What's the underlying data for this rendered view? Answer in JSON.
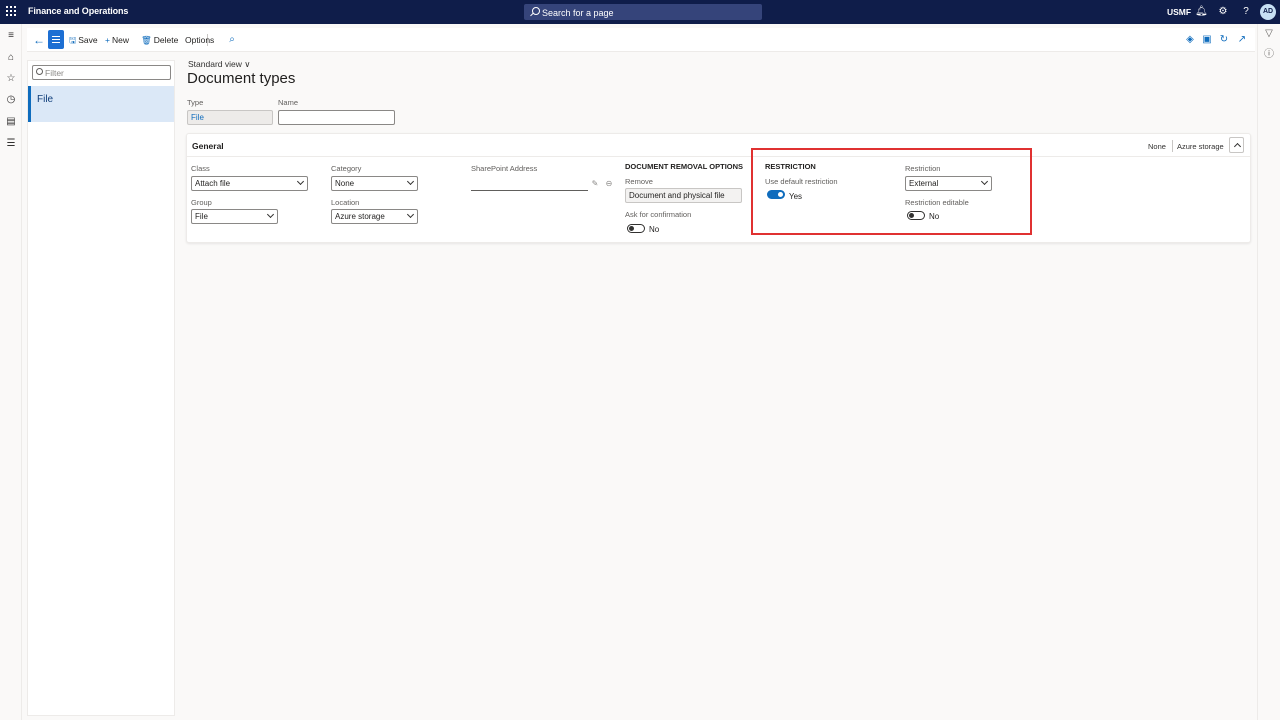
{
  "topbar": {
    "app_title": "Finance and Operations",
    "search_text": "Search for a page",
    "company": "USMF",
    "avatar_initials": "AD",
    "icons": [
      "waffle-icon",
      "search-icon",
      "bell-icon",
      "gear-icon",
      "help-icon"
    ]
  },
  "actionpane": {
    "save_label": "Save",
    "new_label": "New",
    "delete_label": "Delete",
    "options_label": "Options"
  },
  "listpane": {
    "filter_placeholder": "Filter",
    "items": [
      {
        "label": "File",
        "selected": true
      }
    ]
  },
  "main": {
    "view_label": "Standard view",
    "page_title": "Document types",
    "type_label": "Type",
    "type_value": "File",
    "name_label": "Name",
    "name_value": ""
  },
  "general": {
    "title": "General",
    "summary": [
      "None",
      "Azure storage"
    ],
    "class_label": "Class",
    "class_value": "Attach file",
    "group_label": "Group",
    "group_value": "File",
    "category_label": "Category",
    "category_value": "None",
    "location_label": "Location",
    "location_value": "Azure storage",
    "sharepoint_label": "SharePoint Address",
    "sharepoint_value": "",
    "removal_heading": "DOCUMENT REMOVAL OPTIONS",
    "remove_label": "Remove",
    "remove_value": "Document and physical file",
    "confirm_label": "Ask for confirmation",
    "confirm_value": "No",
    "restriction_heading": "RESTRICTION",
    "use_default_label": "Use default restriction",
    "use_default_value": "Yes",
    "restriction_label": "Restriction",
    "restriction_value": "External",
    "editable_label": "Restriction editable",
    "editable_value": "No"
  },
  "colors": {
    "topbar": "#0f1d4a",
    "accent": "#0f6cbd",
    "highlight_box": "#e03131"
  }
}
